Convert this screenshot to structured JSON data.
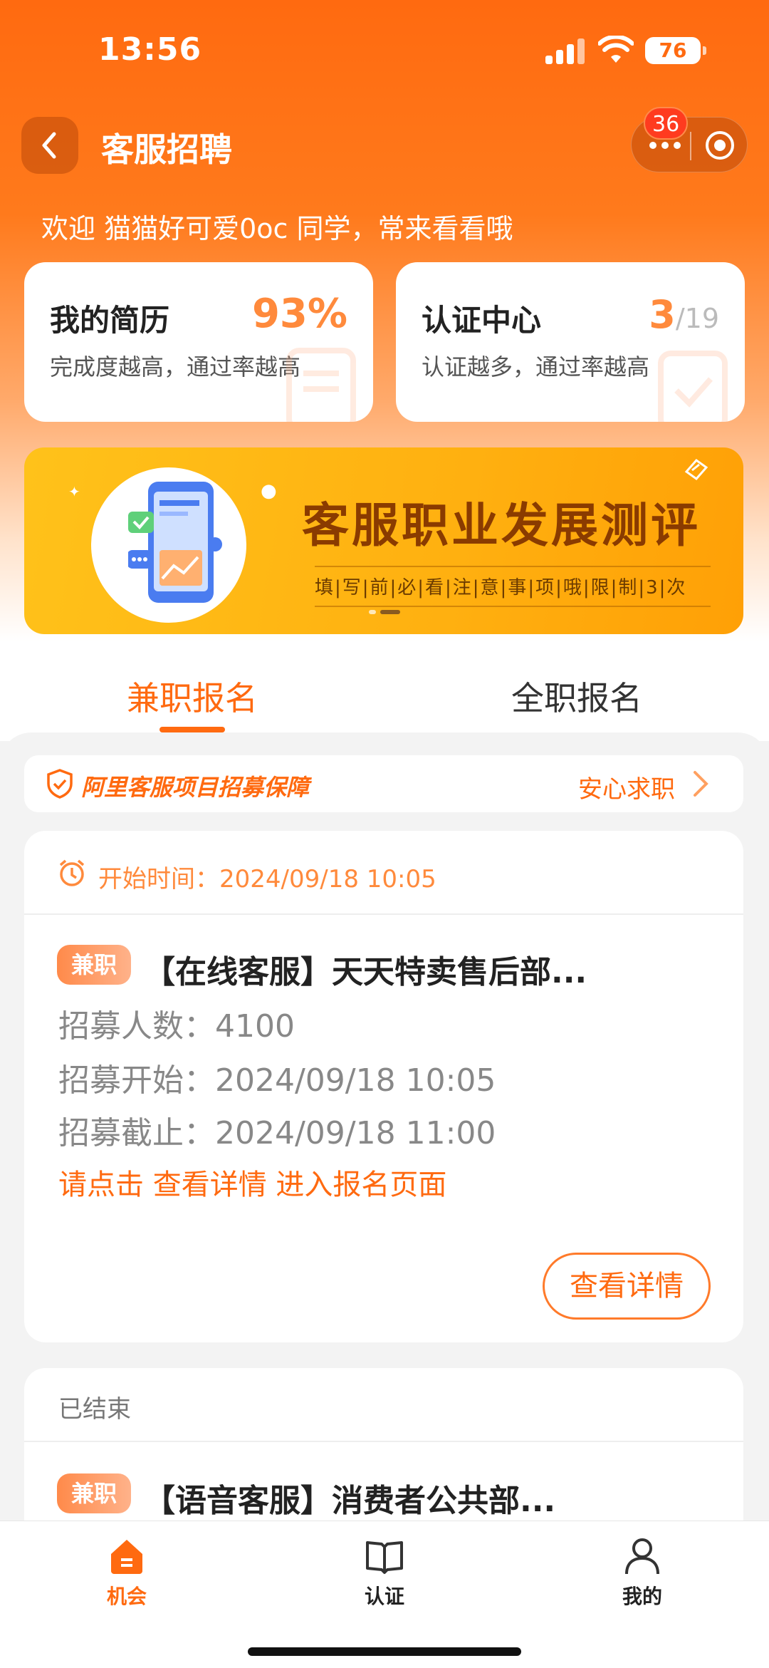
{
  "status_bar": {
    "time": "13:56",
    "battery": "76"
  },
  "nav": {
    "title": "客服招聘",
    "badge": "36"
  },
  "welcome": "欢迎 猫猫好可爱0oc 同学，常来看看哦",
  "resume_card": {
    "title": "我的简历",
    "subtitle": "完成度越高，通过率越高",
    "value": "93%"
  },
  "cert_card": {
    "title": "认证中心",
    "subtitle": "认证越多，通过率越高",
    "done": "3",
    "total": "/19"
  },
  "banner": {
    "title": "客服职业发展测评",
    "subtitle": "填|写|前|必|看|注|意|事|项|哦|限|制|3|次"
  },
  "tabs": [
    {
      "label": "兼职报名",
      "active": true
    },
    {
      "label": "全职报名",
      "active": false
    }
  ],
  "guarantee": {
    "text": "阿里客服项目招募保障",
    "link": "安心求职"
  },
  "jobs": [
    {
      "start_time": "开始时间：2024/09/18 10:05",
      "tag": "兼职",
      "title": "【在线客服】天天特卖售后部...",
      "count": "招募人数：4100",
      "begin": "招募开始：2024/09/18 10:05",
      "deadline": "招募截止：2024/09/18 11:00",
      "hint": "请点击 查看详情 进入报名页面",
      "button": "查看详情"
    },
    {
      "status": "已结束",
      "tag": "兼职",
      "title": "【语音客服】消费者公共部..."
    }
  ],
  "bottom_nav": [
    {
      "label": "机会",
      "icon": "home-icon",
      "active": true
    },
    {
      "label": "认证",
      "icon": "book-icon",
      "active": false
    },
    {
      "label": "我的",
      "icon": "user-icon",
      "active": false
    }
  ],
  "colors": {
    "accent": "#ff6a10",
    "tag": "#ff8a4a"
  }
}
